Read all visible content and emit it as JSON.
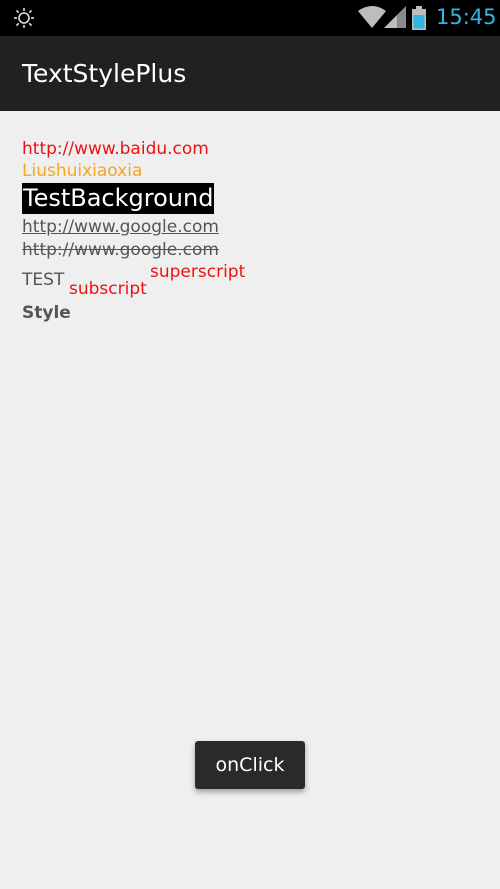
{
  "status_bar": {
    "time": "15:45",
    "icons": [
      "brightness-icon",
      "wifi-icon",
      "signal-icon",
      "battery-icon"
    ],
    "clock_color": "#33b5e5"
  },
  "app": {
    "title": "TextStylePlus"
  },
  "content": {
    "link_text": "http://www.baidu.com",
    "name_text": "Liushuixiaoxia",
    "background_text": "TestBackground",
    "underline_text": "http://www.google.com",
    "strikethrough_text": "http://www.google.com",
    "test_text": "TEST",
    "subscript_text": "subscript",
    "superscript_text": "superscript",
    "style_text": "Style"
  },
  "button": {
    "label": "onClick"
  },
  "colors": {
    "red": "#ee1111",
    "orange": "#f5a623",
    "gray_text": "#555555",
    "action_bar": "#212121"
  }
}
